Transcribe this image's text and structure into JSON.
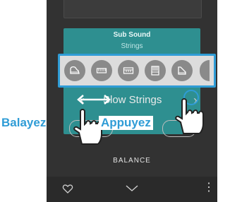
{
  "sound_card": {
    "title": "Sub Sound",
    "subtitle": "Strings"
  },
  "icon_strip": {
    "icons": [
      "grand-piano-icon",
      "electric-piano-icon",
      "synth-keyboard-icon",
      "organ-icon",
      "harpsichord-icon"
    ]
  },
  "tone": {
    "name": "Slow Strings"
  },
  "balance": {
    "label": "BALANCE"
  },
  "annotations": {
    "swipe_label": "Balayez",
    "tap_label": "Appuyez"
  },
  "colors": {
    "accent": "#2f9cd6",
    "card": "#2e8f90",
    "background": "#323232"
  }
}
